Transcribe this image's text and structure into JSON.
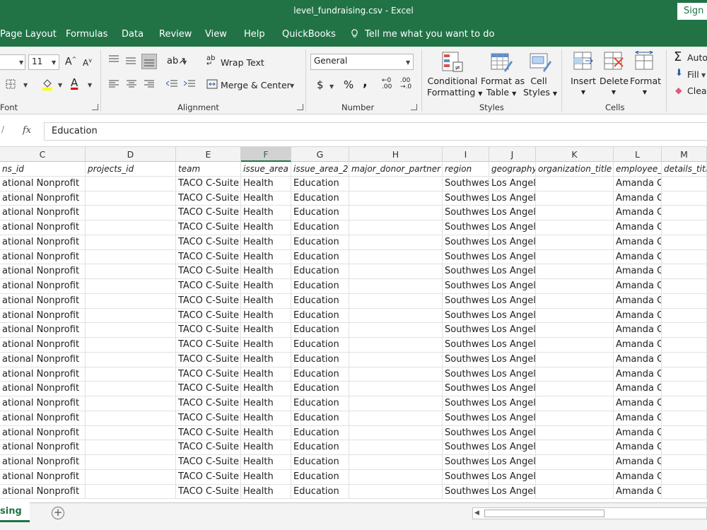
{
  "window": {
    "title": "level_fundraising.csv  -  Excel",
    "signin_label": "Sign in"
  },
  "menu": {
    "items": [
      "Page Layout",
      "Formulas",
      "Data",
      "Review",
      "View",
      "Help",
      "QuickBooks"
    ],
    "tell_me": "Tell me what you want to do"
  },
  "ribbon": {
    "font": {
      "size": "11",
      "group_label": "Font"
    },
    "alignment": {
      "wrap_text": "Wrap Text",
      "merge_center": "Merge & Center",
      "group_label": "Alignment"
    },
    "number": {
      "format": "General",
      "currency": "$",
      "percent": "%",
      "comma": ",",
      "group_label": "Number"
    },
    "styles": {
      "conditional_1": "Conditional",
      "conditional_2": "Formatting",
      "format_table_1": "Format as",
      "format_table_2": "Table",
      "cell_styles_1": "Cell",
      "cell_styles_2": "Styles",
      "group_label": "Styles"
    },
    "cells": {
      "insert": "Insert",
      "delete": "Delete",
      "format": "Format",
      "group_label": "Cells"
    },
    "editing": {
      "autosum": "Auto",
      "fill": "Fill",
      "clear": "Clea"
    }
  },
  "formula_bar": {
    "fx": "fx",
    "value": "Education"
  },
  "columns": [
    {
      "letter": "C",
      "header": "ns_id"
    },
    {
      "letter": "D",
      "header": "projects_id"
    },
    {
      "letter": "E",
      "header": "team"
    },
    {
      "letter": "F",
      "header": "issue_area"
    },
    {
      "letter": "G",
      "header": "issue_area_2"
    },
    {
      "letter": "H",
      "header": "major_donor_partner"
    },
    {
      "letter": "I",
      "header": "region"
    },
    {
      "letter": "J",
      "header": "geography"
    },
    {
      "letter": "K",
      "header": "organization_title"
    },
    {
      "letter": "L",
      "header": "employee_c"
    },
    {
      "letter": "M",
      "header": "details_title"
    }
  ],
  "row_template": {
    "C": "ational Nonprofit",
    "D": "",
    "E": "TACO C-Suite",
    "F": "Health",
    "G": "Education",
    "H": "",
    "I": "Southwes",
    "J": "Los Angeles, CA",
    "K": "",
    "L": "Amanda Grennan",
    "M": ""
  },
  "rows": [
    [
      "ational Nonprofit",
      "",
      "TACO C-Suite",
      "Health",
      "Education",
      "",
      "Southwes",
      "Los Angeles, CA",
      "",
      "Amanda Grennan",
      ""
    ],
    [
      "ational Nonprofit",
      "",
      "TACO C-Suite",
      "Health",
      "Education",
      "",
      "Southwes",
      "Los Angeles, CA",
      "",
      "Amanda Grennan",
      ""
    ],
    [
      "ational Nonprofit",
      "",
      "TACO C-Suite",
      "Health",
      "Education",
      "",
      "Southwes",
      "Los Angeles, CA",
      "",
      "Amanda Grennan",
      ""
    ],
    [
      "ational Nonprofit",
      "",
      "TACO C-Suite",
      "Health",
      "Education",
      "",
      "Southwes",
      "Los Angeles, CA",
      "",
      "Amanda Grennan",
      ""
    ],
    [
      "ational Nonprofit",
      "",
      "TACO C-Suite",
      "Health",
      "Education",
      "",
      "Southwes",
      "Los Angeles, CA",
      "",
      "Amanda Grennan",
      ""
    ],
    [
      "ational Nonprofit",
      "",
      "TACO C-Suite",
      "Health",
      "Education",
      "",
      "Southwes",
      "Los Angeles, CA",
      "",
      "Amanda Grennan",
      ""
    ],
    [
      "ational Nonprofit",
      "",
      "TACO C-Suite",
      "Health",
      "Education",
      "",
      "Southwes",
      "Los Angeles, CA",
      "",
      "Amanda Grennan",
      ""
    ],
    [
      "ational Nonprofit",
      "",
      "TACO C-Suite",
      "Health",
      "Education",
      "",
      "Southwes",
      "Los Angeles, CA",
      "",
      "Amanda Grennan",
      ""
    ],
    [
      "ational Nonprofit",
      "",
      "TACO C-Suite",
      "Health",
      "Education",
      "",
      "Southwes",
      "Los Angeles, CA",
      "",
      "Amanda Grennan",
      ""
    ],
    [
      "ational Nonprofit",
      "",
      "TACO C-Suite",
      "Health",
      "Education",
      "",
      "Southwes",
      "Los Angeles, CA",
      "",
      "Amanda Grennan",
      ""
    ],
    [
      "ational Nonprofit",
      "",
      "TACO C-Suite",
      "Health",
      "Education",
      "",
      "Southwes",
      "Los Angeles, CA",
      "",
      "Amanda Grennan",
      ""
    ],
    [
      "ational Nonprofit",
      "",
      "TACO C-Suite",
      "Health",
      "Education",
      "",
      "Southwes",
      "Los Angeles, CA",
      "",
      "Amanda Grennan",
      ""
    ],
    [
      "ational Nonprofit",
      "",
      "TACO C-Suite",
      "Health",
      "Education",
      "",
      "Southwes",
      "Los Angeles, CA",
      "",
      "Amanda Grennan",
      ""
    ],
    [
      "ational Nonprofit",
      "",
      "TACO C-Suite",
      "Health",
      "Education",
      "",
      "Southwes",
      "Los Angeles, CA",
      "",
      "Amanda Grennan",
      ""
    ],
    [
      "ational Nonprofit",
      "",
      "TACO C-Suite",
      "Health",
      "Education",
      "",
      "Southwes",
      "Los Angeles, CA",
      "",
      "Amanda Grennan",
      ""
    ],
    [
      "ational Nonprofit",
      "",
      "TACO C-Suite",
      "Health",
      "Education",
      "",
      "Southwes",
      "Los Angeles, CA",
      "",
      "Amanda Grennan",
      ""
    ],
    [
      "ational Nonprofit",
      "",
      "TACO C-Suite",
      "Health",
      "Education",
      "",
      "Southwes",
      "Los Angeles, CA",
      "",
      "Amanda Grennan",
      ""
    ],
    [
      "ational Nonprofit",
      "",
      "TACO C-Suite",
      "Health",
      "Education",
      "",
      "Southwes",
      "Los Angeles, CA",
      "",
      "Amanda Grennan",
      ""
    ],
    [
      "ational Nonprofit",
      "",
      "TACO C-Suite",
      "Health",
      "Education",
      "",
      "Southwes",
      "Los Angeles, CA",
      "",
      "Amanda Grennan",
      ""
    ],
    [
      "ational Nonprofit",
      "",
      "TACO C-Suite",
      "Health",
      "Education",
      "",
      "Southwes",
      "Los Angeles, CA",
      "",
      "Amanda Grennan",
      ""
    ],
    [
      "ational Nonprofit",
      "",
      "TACO C-Suite",
      "Health",
      "Education",
      "",
      "Southwes",
      "Los Angeles, CA",
      "",
      "Amanda Grennan",
      ""
    ],
    [
      "ational Nonprofit",
      "",
      "TACO C-Suite",
      "Health",
      "Education",
      "",
      "Southwes",
      "Los Angeles, CA",
      "",
      "Amanda Grennan",
      ""
    ]
  ],
  "selected_column": "F",
  "sheet": {
    "active_tab": "sing"
  },
  "colors": {
    "accent": "#217346"
  }
}
